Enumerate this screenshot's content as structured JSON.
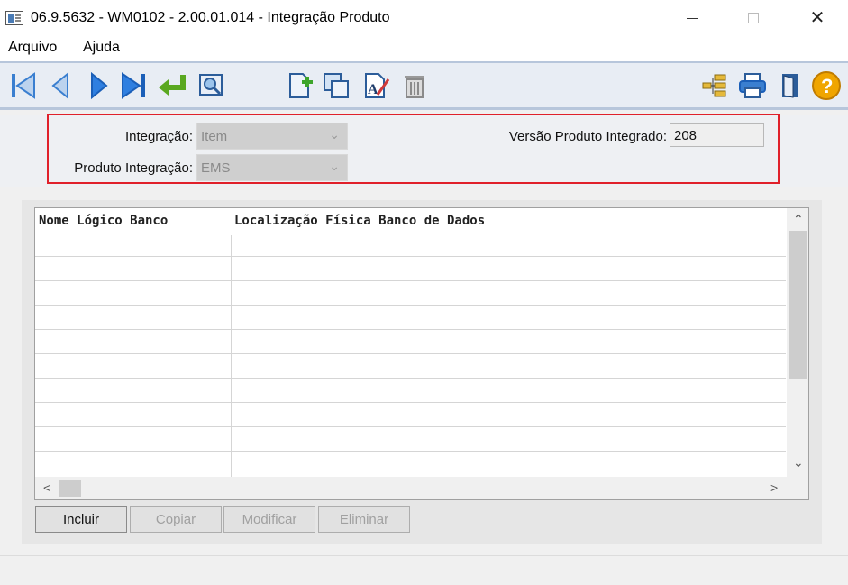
{
  "window": {
    "title": "06.9.5632 - WM0102 - 2.00.01.014 - Integração Produto",
    "close_glyph": "✕"
  },
  "menu": {
    "items": [
      {
        "label": "Arquivo"
      },
      {
        "label": "Ajuda"
      }
    ]
  },
  "toolbar": {
    "icons": [
      "first-record-icon",
      "previous-record-icon",
      "next-record-icon",
      "last-record-icon",
      "go-to-icon",
      "search-icon",
      "new-record-icon",
      "copy-icon",
      "edit-icon",
      "delete-icon",
      "tree-icon",
      "print-icon",
      "exit-icon",
      "help-icon"
    ],
    "help_glyph": "?"
  },
  "form": {
    "integracao_label": "Integração:",
    "integracao_value": "Item",
    "produto_integracao_label": "Produto Integração:",
    "produto_integracao_value": "EMS",
    "versao_label": "Versão Produto Integrado:",
    "versao_value": "208",
    "accent_color": "#e0202a"
  },
  "table": {
    "columns": [
      {
        "label": "Nome Lógico Banco"
      },
      {
        "label": "Localização Física  Banco de Dados"
      }
    ],
    "rows": []
  },
  "scroll": {
    "up": "⌃",
    "down": "⌄",
    "left": "<",
    "right": ">"
  },
  "actions": {
    "incluir": "Incluir",
    "copiar": "Copiar",
    "modificar": "Modificar",
    "eliminar": "Eliminar"
  }
}
